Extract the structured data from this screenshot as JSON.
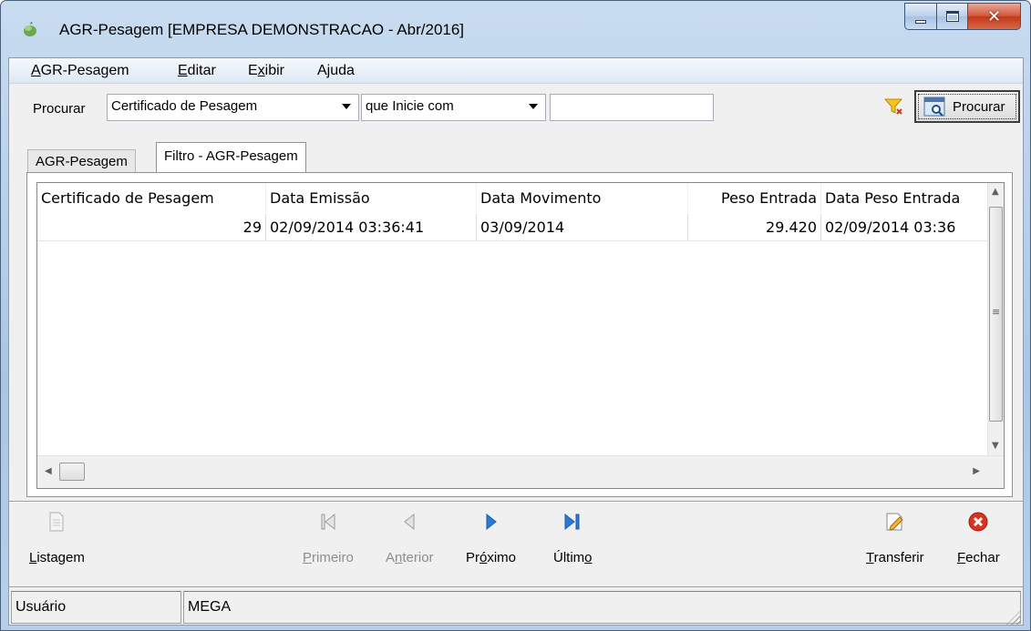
{
  "window": {
    "title": "AGR-Pesagem [EMPRESA DEMONSTRACAO - Abr/2016]",
    "app_icon": "leaf-icon",
    "accent": "#aac6e6",
    "close_color": "#c2381a"
  },
  "menu": {
    "items": [
      {
        "label_u": "A",
        "label_rest": "GR-Pesagem"
      },
      {
        "label_u": "E",
        "label_rest": "ditar"
      },
      {
        "label_pre": "E",
        "label_u": "x",
        "label_rest": "ibir"
      },
      {
        "label_pre": "A",
        "label_u": "j",
        "label_rest": "uda"
      }
    ]
  },
  "search": {
    "label": "Procurar",
    "field_value": "Certificado de Pesagem",
    "mode_value": "que Inicie com",
    "text_value": "",
    "filter_icon": "funnel-icon",
    "button_label": "Procurar",
    "button_icon": "search-window-icon"
  },
  "tabs": [
    {
      "label": "AGR-Pesagem",
      "active": false
    },
    {
      "label": "Filtro - AGR-Pesagem",
      "active": true
    }
  ],
  "grid": {
    "columns": [
      "Certificado de Pesagem",
      "Data Emissão",
      "Data Movimento",
      "Peso Entrada",
      "Data Peso Entrada"
    ],
    "rows": [
      [
        "29",
        "02/09/2014 03:36:41",
        "03/09/2014",
        "29.420",
        "02/09/2014 03:36"
      ]
    ]
  },
  "nav": {
    "listagem": {
      "u": "L",
      "rest": "istagem",
      "icon": "document-icon"
    },
    "primeiro": {
      "u": "P",
      "rest": "rimeiro",
      "icon": "first-icon",
      "enabled": false
    },
    "anterior": {
      "pre": "A",
      "u": "n",
      "rest": "terior",
      "icon": "previous-icon",
      "enabled": false
    },
    "proximo": {
      "pre": "Pr",
      "u": "ó",
      "rest": "ximo",
      "icon": "next-icon",
      "enabled": true
    },
    "ultimo": {
      "pre": "Últim",
      "u": "o",
      "rest": "",
      "icon": "last-icon",
      "enabled": true
    },
    "transferir": {
      "u": "T",
      "rest": "ransferir",
      "icon": "edit-document-icon"
    },
    "fechar": {
      "u": "F",
      "rest": "echar",
      "icon": "close-circle-icon"
    }
  },
  "status": {
    "user_label": "Usuário",
    "user_value": "MEGA"
  }
}
